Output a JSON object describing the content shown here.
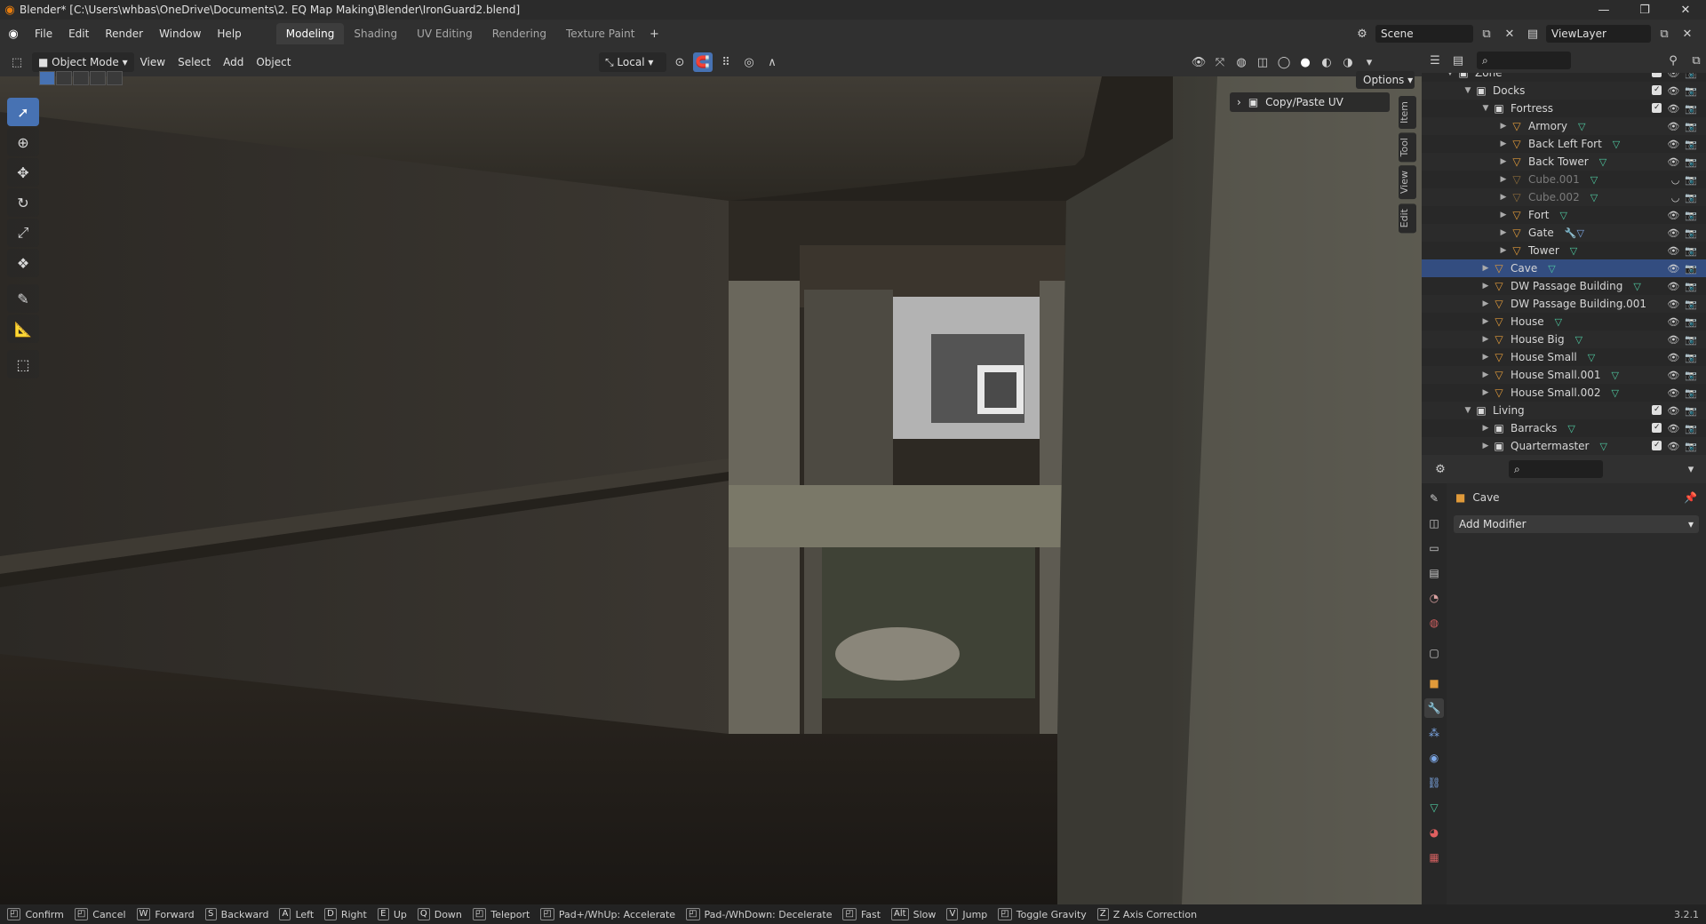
{
  "window": {
    "title": "Blender* [C:\\Users\\whbas\\OneDrive\\Documents\\2. EQ Map Making\\Blender\\IronGuard2.blend]"
  },
  "menu": [
    "File",
    "Edit",
    "Render",
    "Window",
    "Help"
  ],
  "workspaces": [
    "Modeling",
    "Shading",
    "UV Editing",
    "Rendering",
    "Texture Paint"
  ],
  "active_workspace": "Modeling",
  "scene": {
    "label": "Scene",
    "view_layer": "ViewLayer"
  },
  "viewport_header": {
    "mode": "Object Mode",
    "menus": [
      "View",
      "Select",
      "Add",
      "Object"
    ],
    "transform_orientation": "Local",
    "options_label": "Options"
  },
  "npanel": {
    "title": "Copy/Paste UV",
    "tabs": [
      "Item",
      "Tool",
      "View",
      "Edit"
    ]
  },
  "outliner": {
    "rows": [
      {
        "label": "Zone",
        "kind": "collection",
        "depth": 0,
        "expanded": true,
        "checkbox": true
      },
      {
        "label": "Docks",
        "kind": "collection",
        "depth": 1,
        "expanded": true,
        "checkbox": true
      },
      {
        "label": "Fortress",
        "kind": "collection",
        "depth": 2,
        "expanded": true,
        "checkbox": true
      },
      {
        "label": "Armory",
        "kind": "mesh",
        "depth": 3,
        "badge": "mesh"
      },
      {
        "label": "Back Left Fort",
        "kind": "mesh",
        "depth": 3,
        "badge": "mesh"
      },
      {
        "label": "Back Tower",
        "kind": "mesh",
        "depth": 3,
        "badge": "mesh"
      },
      {
        "label": "Cube.001",
        "kind": "mesh",
        "depth": 3,
        "badge": "mesh",
        "hidden": true
      },
      {
        "label": "Cube.002",
        "kind": "mesh",
        "depth": 3,
        "badge": "mesh",
        "hidden": true
      },
      {
        "label": "Fort",
        "kind": "mesh",
        "depth": 3,
        "badge": "mesh"
      },
      {
        "label": "Gate",
        "kind": "mesh",
        "depth": 3,
        "badge": "modifier+mesh"
      },
      {
        "label": "Tower",
        "kind": "mesh",
        "depth": 3,
        "badge": "mesh"
      },
      {
        "label": "Cave",
        "kind": "mesh",
        "depth": 2,
        "badge": "mesh",
        "selected": true
      },
      {
        "label": "DW Passage Building",
        "kind": "mesh",
        "depth": 2,
        "badge": "mesh"
      },
      {
        "label": "DW Passage Building.001",
        "kind": "mesh",
        "depth": 2,
        "badge": ""
      },
      {
        "label": "House",
        "kind": "mesh",
        "depth": 2,
        "badge": "mesh"
      },
      {
        "label": "House Big",
        "kind": "mesh",
        "depth": 2,
        "badge": "mesh"
      },
      {
        "label": "House Small",
        "kind": "mesh",
        "depth": 2,
        "badge": "mesh"
      },
      {
        "label": "House Small.001",
        "kind": "mesh",
        "depth": 2,
        "badge": "mesh"
      },
      {
        "label": "House Small.002",
        "kind": "mesh",
        "depth": 2,
        "badge": "mesh"
      },
      {
        "label": "Living",
        "kind": "collection",
        "depth": 1,
        "expanded": true,
        "checkbox": true
      },
      {
        "label": "Barracks",
        "kind": "collection",
        "depth": 2,
        "badge": "mesh",
        "checkbox": true
      },
      {
        "label": "Quartermaster",
        "kind": "collection",
        "depth": 2,
        "badge": "mesh",
        "checkbox": true
      }
    ]
  },
  "properties": {
    "object_name": "Cave",
    "add_modifier_label": "Add Modifier"
  },
  "statusbar": {
    "items": [
      {
        "key": "",
        "label": "Confirm"
      },
      {
        "key": "",
        "label": "Cancel"
      },
      {
        "key": "W",
        "label": "Forward"
      },
      {
        "key": "S",
        "label": "Backward"
      },
      {
        "key": "A",
        "label": "Left"
      },
      {
        "key": "D",
        "label": "Right"
      },
      {
        "key": "E",
        "label": "Up"
      },
      {
        "key": "Q",
        "label": "Down"
      },
      {
        "key": "",
        "label": "Teleport"
      },
      {
        "key": "",
        "label": "Pad+/WhUp: Accelerate"
      },
      {
        "key": "",
        "label": "Pad-/WhDown: Decelerate"
      },
      {
        "key": "",
        "label": "Fast"
      },
      {
        "key": "Alt",
        "label": "Slow"
      },
      {
        "key": "V",
        "label": "Jump"
      },
      {
        "key": "",
        "label": "Toggle Gravity"
      },
      {
        "key": "Z",
        "label": "Z Axis Correction"
      }
    ],
    "version": "3.2.1"
  },
  "colors": {
    "accent": "#4772b3",
    "selected_row": "#334d80",
    "object_orange": "#e09a3a",
    "mesh_green": "#4fc9a0"
  }
}
